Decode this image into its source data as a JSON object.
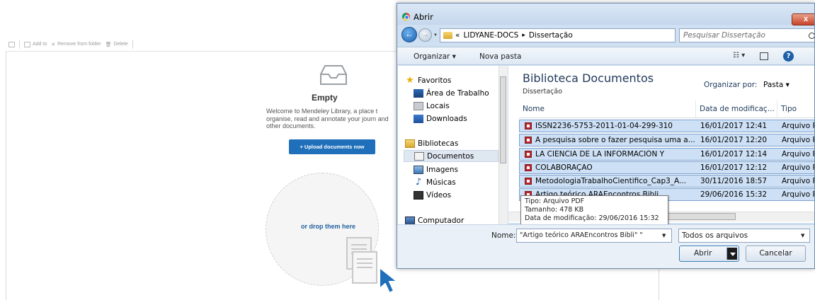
{
  "mendeley": {
    "toolbar": {
      "add_to": "Add to",
      "remove_from_folder": "Remove from folder",
      "delete": "Delete"
    },
    "empty_title": "Empty",
    "welcome_text": "Welcome to Mendeley Library, a place t organise, read and annotate your journ and other documents.",
    "upload_button": "+ Upload documents now",
    "drop_text": "or drop them here",
    "brand_blue": "#1f6fba"
  },
  "dialog": {
    "title": "Abrir",
    "close_label": "x",
    "address": {
      "overflow": "«",
      "crumbs": [
        "LIDYANE-DOCS",
        "Dissertação"
      ]
    },
    "search_placeholder": "Pesquisar Dissertação",
    "commands": {
      "organize": "Organizar ▾",
      "new_folder": "Nova pasta"
    },
    "nav": {
      "favorites": "Favoritos",
      "desktop": "Área de Trabalho",
      "locais": "Locais",
      "downloads": "Downloads",
      "libraries": "Bibliotecas",
      "documents": "Documentos",
      "images": "Imagens",
      "music": "Músicas",
      "videos": "Vídeos",
      "computer": "Computador"
    },
    "library": {
      "title": "Biblioteca Documentos",
      "subtitle": "Dissertação",
      "arrange_label": "Organizar por:",
      "arrange_value": "Pasta ▾"
    },
    "columns": {
      "name": "Nome",
      "date": "Data de modificaç...",
      "type": "Tipo"
    },
    "files": [
      {
        "name": "ISSN2236-5753-2011-01-04-299-310",
        "date": "16/01/2017 12:41",
        "type": "Arquivo P"
      },
      {
        "name": "A pesquisa sobre o fazer pesquisa uma a...",
        "date": "16/01/2017 12:20",
        "type": "Arquivo P"
      },
      {
        "name": "LA CIENCIA DE LA INFORMACIÓN Y",
        "date": "16/01/2017 12:14",
        "type": "Arquivo P"
      },
      {
        "name": "COLABORAÇÃO",
        "date": "16/01/2017 12:12",
        "type": "Arquivo P"
      },
      {
        "name": "MetodologiaTrabalhoCientifico_Cap3_A...",
        "date": "30/11/2016 18:57",
        "type": "Arquivo P"
      },
      {
        "name": "Artigo teórico ARAEncontros Bibli",
        "date": "29/06/2016 15:32",
        "type": "Arquivo P"
      }
    ],
    "tooltip": {
      "type": "Tipo: Arquivo PDF",
      "size": "Tamanho: 478 KB",
      "modified": "Data de modificação: 29/06/2016 15:32"
    },
    "footer": {
      "name_label": "Nome:",
      "name_value": "\"Artigo teórico ARAEncontros Bibli\" \"",
      "file_type": "Todos os arquivos",
      "open": "Abrir",
      "cancel": "Cancelar"
    }
  }
}
